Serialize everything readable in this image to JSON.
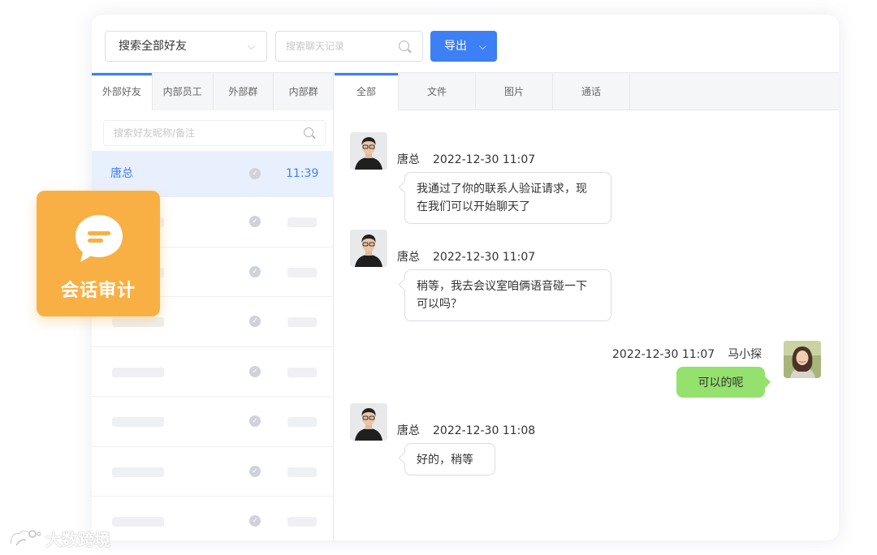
{
  "toolbar": {
    "select_label": "搜索全部好友",
    "search_placeholder": "搜索聊天记录",
    "export_label": "导出"
  },
  "left_tabs": [
    "外部好友",
    "内部员工",
    "外部群",
    "内部群"
  ],
  "left_search_placeholder": "搜索好友昵称/备注",
  "contacts": [
    {
      "name": "唐总",
      "time": "11:39"
    }
  ],
  "right_tabs": [
    "全部",
    "文件",
    "图片",
    "通话"
  ],
  "messages": [
    {
      "sender": "唐总",
      "date": "2022-12-30",
      "time": "11:07",
      "text_lines": [
        "我通过了你的联系人验证请求，现",
        "在我们可以开始聊天了"
      ]
    },
    {
      "sender": "唐总",
      "date": "2022-12-30",
      "time": "11:07",
      "text_lines": [
        "稍等，我去会议室咱俩语音碰一下",
        "可以吗？"
      ]
    },
    {
      "sender": "马小探",
      "date": "2022-12-30",
      "time": "11:07",
      "text_lines": [
        "可以的呢"
      ]
    },
    {
      "sender": "唐总",
      "date": "2022-12-30",
      "time": "11:08",
      "text_lines": [
        "好的，稍等"
      ]
    }
  ],
  "badge": {
    "label": "会话审计",
    "color": "#f8b045"
  },
  "watermark": "大数跨境",
  "colors": {
    "accent": "#3d7ff5",
    "self_bubble": "#94e16d",
    "badge": "#f8b045"
  },
  "icons": [
    "chevron-down-icon",
    "search-icon",
    "check-circle-icon",
    "chat-bubble-icon"
  ]
}
